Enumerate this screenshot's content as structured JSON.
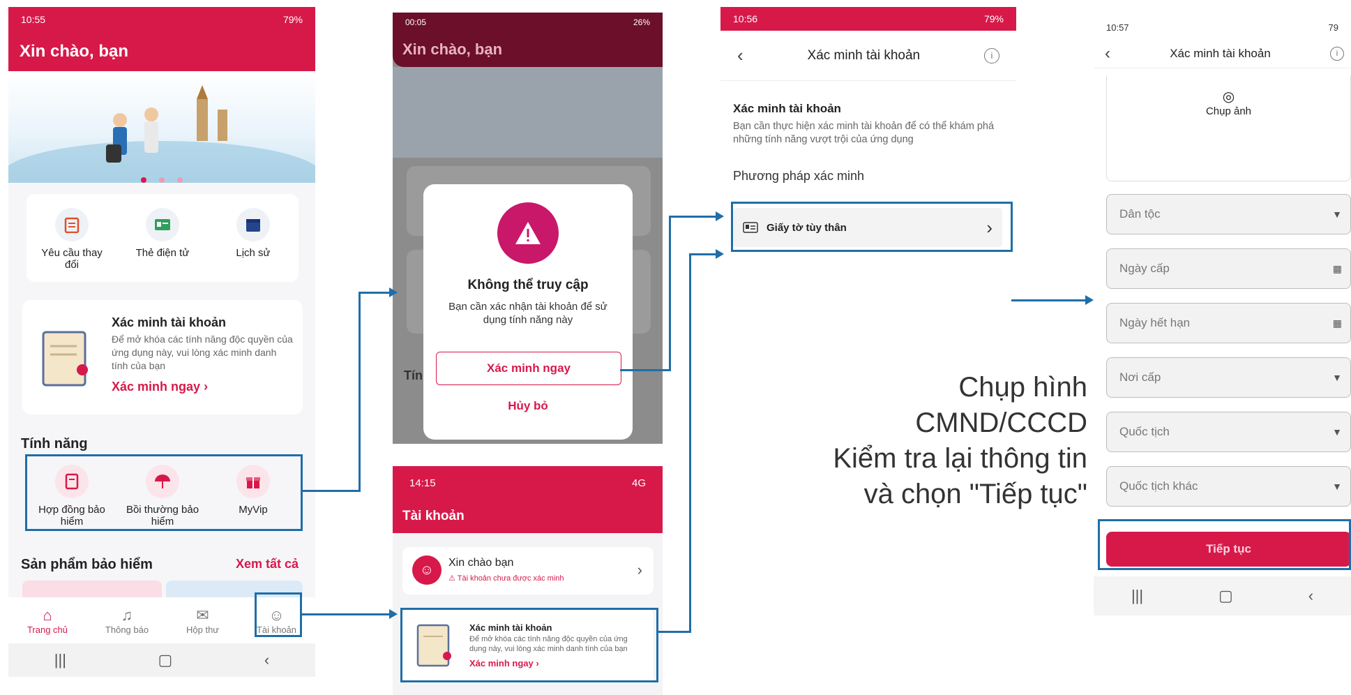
{
  "screen1": {
    "status_time": "10:55",
    "status_right": "79%",
    "greeting": "Xin chào, bạn",
    "quick_actions": [
      {
        "label": "Yêu cầu thay đổi",
        "icon": "clipboard-icon"
      },
      {
        "label": "Thẻ điện tử",
        "icon": "id-card-icon"
      },
      {
        "label": "Lịch sử",
        "icon": "calendar-icon"
      }
    ],
    "verify_card": {
      "title": "Xác minh tài khoản",
      "desc": "Để mở khóa các tính năng độc quyền của ứng dụng này, vui lòng xác minh danh tính của bạn",
      "cta": "Xác minh ngay"
    },
    "features_title": "Tính năng",
    "features": [
      {
        "label": "Hợp đồng bảo hiểm",
        "icon": "contract-icon"
      },
      {
        "label": "Bồi thường bảo hiểm",
        "icon": "umbrella-icon"
      },
      {
        "label": "MyVip",
        "icon": "gift-icon"
      }
    ],
    "products_title": "Sản phẩm bảo hiểm",
    "see_all": "Xem tất cả",
    "bottom_nav": [
      {
        "label": "Trang chủ",
        "icon": "home-icon"
      },
      {
        "label": "Thông báo",
        "icon": "bell-icon"
      },
      {
        "label": "Hộp thư",
        "icon": "mail-icon"
      },
      {
        "label": "Tài khoản",
        "icon": "user-icon"
      }
    ]
  },
  "screen2": {
    "status_time": "00:05",
    "status_right": "26%",
    "greeting": "Xin chào, bạn",
    "bg_label": "Tính",
    "dialog": {
      "title": "Không thể truy cập",
      "message": "Bạn cần xác nhận tài khoản để sử dụng tính năng này",
      "primary": "Xác minh ngay",
      "secondary": "Hủy bỏ"
    }
  },
  "screen3": {
    "status_time": "14:15",
    "status_right": "4G",
    "title": "Tài khoản",
    "user_name": "Xin chào bạn",
    "user_warning": "Tài khoản chưa được xác minh",
    "verify_card": {
      "title": "Xác minh tài khoản",
      "desc": "Để mở khóa các tính năng độc quyền của ứng dụng này, vui lòng xác minh danh tính của bạn",
      "cta": "Xác minh ngay"
    }
  },
  "screen4": {
    "status_time": "10:56",
    "status_right": "79%",
    "title": "Xác minh tài khoản",
    "section_title": "Xác minh tài khoản",
    "section_desc": "Bạn cần thực hiện xác minh tài khoản để có thể khám phá những tính năng vượt trội của ứng dụng",
    "method_title": "Phương pháp xác minh",
    "method_option": "Giấy tờ tùy thân"
  },
  "screen5": {
    "status_time": "10:57",
    "status_right": "79",
    "title": "Xác minh tài khoản",
    "photo_label": "Chụp ảnh",
    "fields": [
      {
        "placeholder": "Dân tộc",
        "suffix": "▼"
      },
      {
        "placeholder": "Ngày cấp",
        "suffix": "▦"
      },
      {
        "placeholder": "Ngày hết hạn",
        "suffix": "▦"
      },
      {
        "placeholder": "Nơi cấp",
        "suffix": "▼"
      },
      {
        "placeholder": "Quốc tịch",
        "suffix": "▼"
      },
      {
        "placeholder": "Quốc tịch khác",
        "suffix": "▼"
      }
    ],
    "continue": "Tiếp tục"
  },
  "caption_lines": [
    "Chụp hình",
    "CMND/CCCD",
    "Kiểm tra lại thông tin",
    "và chọn \"Tiếp tục\""
  ],
  "colors": {
    "brand": "#d7194a",
    "annotation": "#1f6ea8"
  }
}
